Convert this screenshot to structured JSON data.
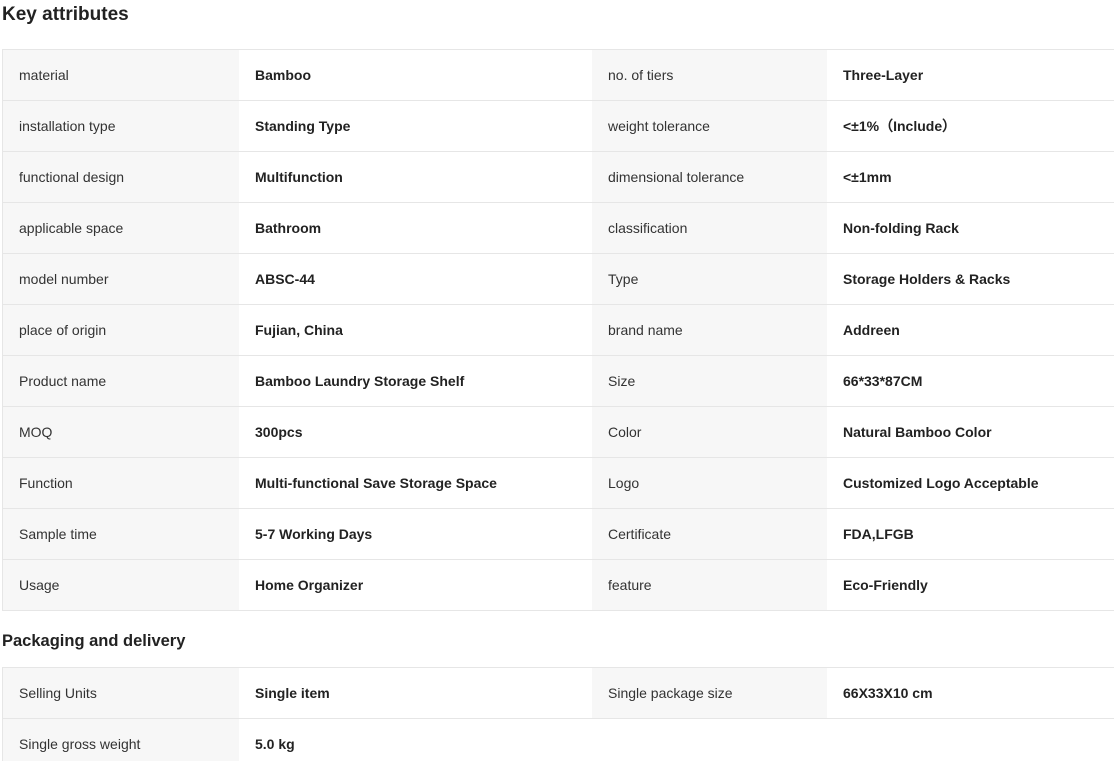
{
  "key_attributes": {
    "title": "Key attributes",
    "rows": [
      {
        "l1": "material",
        "v1": "Bamboo",
        "l2": "no. of tiers",
        "v2": "Three-Layer"
      },
      {
        "l1": "installation type",
        "v1": "Standing Type",
        "l2": "weight tolerance",
        "v2": "<±1%（Include）"
      },
      {
        "l1": "functional design",
        "v1": "Multifunction",
        "l2": "dimensional tolerance",
        "v2": "<±1mm"
      },
      {
        "l1": "applicable space",
        "v1": "Bathroom",
        "l2": "classification",
        "v2": "Non-folding Rack"
      },
      {
        "l1": "model number",
        "v1": "ABSC-44",
        "l2": "Type",
        "v2": "Storage Holders & Racks"
      },
      {
        "l1": "place of origin",
        "v1": "Fujian, China",
        "l2": "brand name",
        "v2": "Addreen"
      },
      {
        "l1": "Product name",
        "v1": "Bamboo Laundry Storage Shelf",
        "l2": "Size",
        "v2": "66*33*87CM"
      },
      {
        "l1": "MOQ",
        "v1": "300pcs",
        "l2": "Color",
        "v2": "Natural Bamboo Color"
      },
      {
        "l1": "Function",
        "v1": "Multi-functional Save Storage Space",
        "l2": "Logo",
        "v2": "Customized Logo Acceptable"
      },
      {
        "l1": "Sample time",
        "v1": "5-7 Working Days",
        "l2": "Certificate",
        "v2": "FDA,LFGB"
      },
      {
        "l1": "Usage",
        "v1": "Home Organizer",
        "l2": "feature",
        "v2": "Eco-Friendly"
      }
    ]
  },
  "packaging": {
    "title": "Packaging and delivery",
    "rows": [
      {
        "l1": "Selling Units",
        "v1": "Single item",
        "l2": "Single package size",
        "v2": "66X33X10 cm"
      },
      {
        "l1": "Single gross weight",
        "v1": "5.0 kg"
      }
    ]
  }
}
